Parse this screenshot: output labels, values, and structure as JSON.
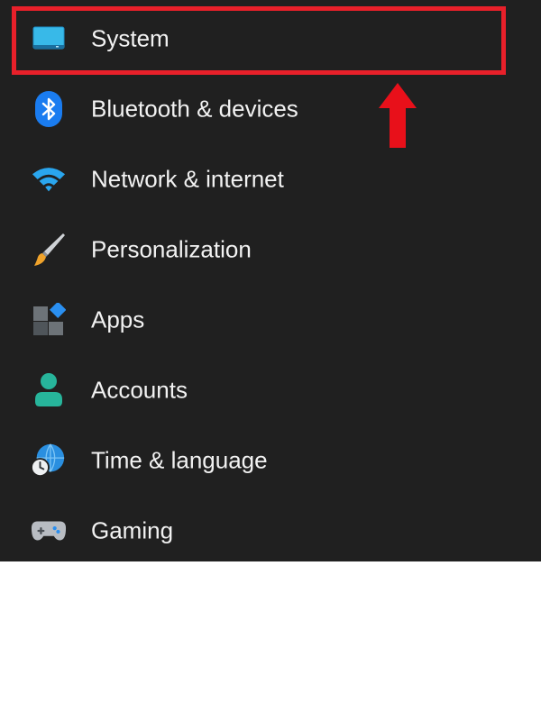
{
  "sidebar": {
    "items": [
      {
        "label": "System",
        "icon": "monitor-icon",
        "selected": true
      },
      {
        "label": "Bluetooth & devices",
        "icon": "bluetooth-icon"
      },
      {
        "label": "Network & internet",
        "icon": "wifi-icon"
      },
      {
        "label": "Personalization",
        "icon": "paintbrush-icon"
      },
      {
        "label": "Apps",
        "icon": "apps-icon"
      },
      {
        "label": "Accounts",
        "icon": "person-icon"
      },
      {
        "label": "Time & language",
        "icon": "globe-clock-icon"
      },
      {
        "label": "Gaming",
        "icon": "gamepad-icon"
      }
    ]
  },
  "colors": {
    "panel_bg": "#202020",
    "text": "#f2f2f2",
    "annotation_red": "#e8202a",
    "accent_blue": "#0078d4"
  }
}
